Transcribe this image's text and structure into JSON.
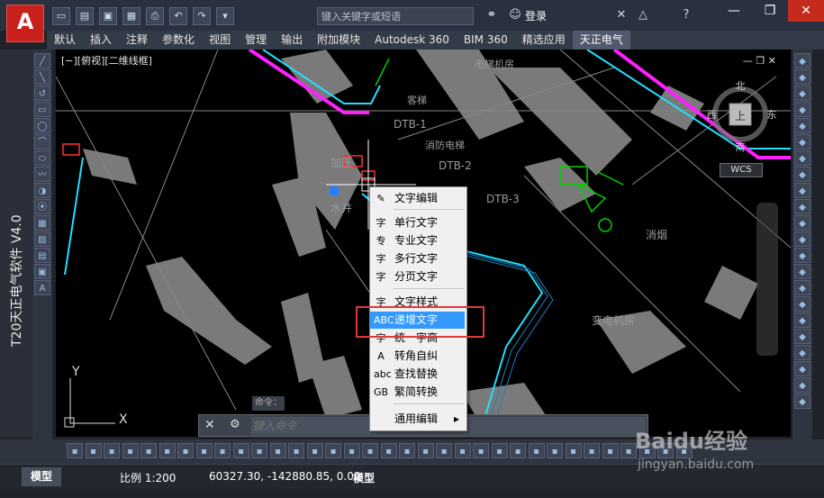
{
  "app": {
    "logo_letter": "A",
    "vertical_title": "T20天正电气软件 V4.0",
    "search_placeholder": "键入关键字或短语",
    "login_label": "登录",
    "window_buttons": [
      "—",
      "❐",
      "✕"
    ]
  },
  "ribbon_tabs": [
    "默认",
    "插入",
    "注释",
    "参数化",
    "视图",
    "管理",
    "输出",
    "附加模块",
    "Autodesk 360",
    "BIM 360",
    "精选应用",
    "天正电气"
  ],
  "active_tab": "天正电气",
  "viewport": {
    "label": "[−][俯视][二维线框]",
    "compass": {
      "north": "北",
      "south": "南",
      "east": "东",
      "west": "西",
      "top": "上"
    },
    "wcs_label": "WCS",
    "axis_x": "X",
    "axis_y": "Y"
  },
  "drawing_labels": {
    "dtb1": "DTB-1",
    "dtb2": "DTB-2",
    "dtb3": "DTB-3",
    "elevator": "消防电梯",
    "pressure": "加压",
    "well": "水井",
    "smoke": "消烟",
    "transformer": "变电机房",
    "room": "电梯机房",
    "room2": "客梯"
  },
  "context_menu": {
    "items": [
      {
        "icon": "✎",
        "label": "文字编辑"
      },
      {
        "icon": "字",
        "label": "单行文字"
      },
      {
        "icon": "专",
        "label": "专业文字"
      },
      {
        "icon": "字",
        "label": "多行文字"
      },
      {
        "icon": "字",
        "label": "分页文字"
      },
      {
        "icon": "字",
        "label": "文字样式"
      },
      {
        "icon": "ABC",
        "label": "递增文字"
      },
      {
        "icon": "字",
        "label": "统一字高"
      },
      {
        "icon": "A",
        "label": "转角自纠"
      },
      {
        "icon": "abc",
        "label": "查找替换"
      },
      {
        "icon": "GB",
        "label": "繁简转换"
      },
      {
        "icon": "",
        "label": "通用编辑"
      }
    ],
    "highlighted": "递增文字",
    "submenu_arrow": "▸"
  },
  "command_line": {
    "close": "✕",
    "tool": "🔧",
    "placeholder": "键入命令",
    "tab_label": "命令："
  },
  "status_bar": {
    "model_tab": "模型",
    "scale": "比例 1:200",
    "coords": "60327.30, -142880.85, 0.00",
    "mode": "模型"
  },
  "watermark": {
    "text": "Baidu经验",
    "url": "jingyan.baidu.com"
  },
  "colors": {
    "accent_red": "#c8201a",
    "magenta": "#ff20ff",
    "cyan": "#20e0ff",
    "green": "#00d000",
    "highlight": "#3399ff"
  }
}
